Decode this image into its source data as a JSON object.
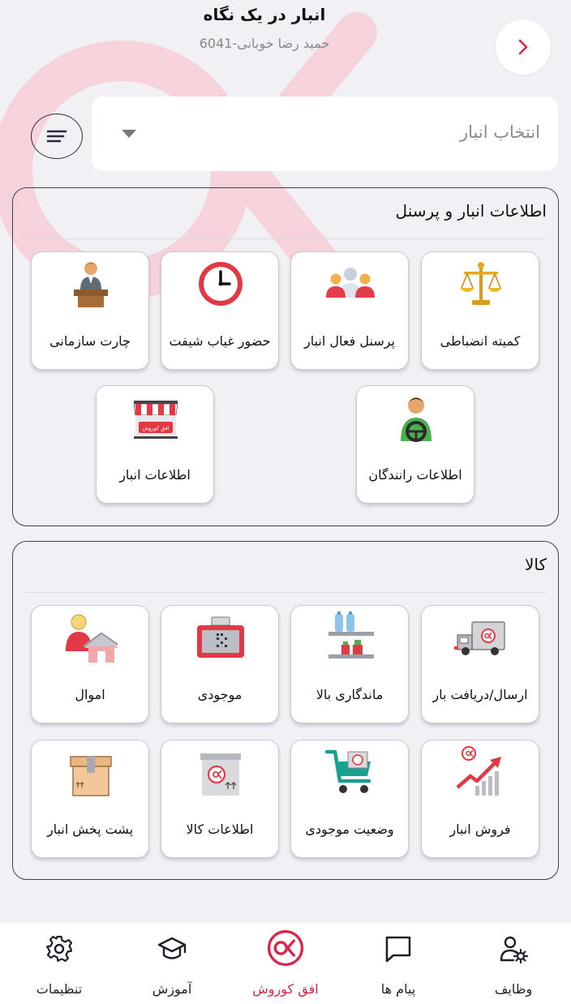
{
  "header": {
    "title": "انبار در یک نگاه",
    "subtitle": "حمید رضا خوبانی-6041"
  },
  "search": {
    "placeholder": "انتخاب انبار"
  },
  "sections": [
    {
      "title": "اطلاعات انبار و پرسنل",
      "cards": [
        {
          "label": "کمیته انضباطی",
          "icon": "scales-of-justice-icon"
        },
        {
          "label": "پرسنل فعال انبار",
          "icon": "people-group-icon"
        },
        {
          "label": "حضور غیاب شیفت",
          "icon": "clock-icon"
        },
        {
          "label": "چارت سازمانی",
          "icon": "speaker-podium-icon"
        },
        {
          "label": "اطلاعات رانندگان",
          "icon": "driver-icon"
        },
        {
          "label": "اطلاعات انبار",
          "icon": "store-awning-icon"
        }
      ]
    },
    {
      "title": "کالا",
      "cards": [
        {
          "label": "ارسال/دریافت بار",
          "icon": "delivery-truck-icon"
        },
        {
          "label": "ماندگاری بالا",
          "icon": "shelf-bottles-icon"
        },
        {
          "label": "موجودی",
          "icon": "cash-register-icon"
        },
        {
          "label": "اموال",
          "icon": "person-house-icon"
        },
        {
          "label": "فروش انبار",
          "icon": "sales-growth-chart-icon"
        },
        {
          "label": "وضعیت موجودی",
          "icon": "shopping-cart-icon"
        },
        {
          "label": "اطلاعات کالا",
          "icon": "product-box-icon"
        },
        {
          "label": "پشت پخش انبار",
          "icon": "parcel-box-icon"
        }
      ]
    }
  ],
  "store_badge_text": "افق کوروش",
  "bottom_nav": [
    {
      "label": "وظایف",
      "icon": "user-gear-icon"
    },
    {
      "label": "پیام ها",
      "icon": "message-icon"
    },
    {
      "label": "افق کوروش",
      "icon": "ofogh-logo-icon",
      "active": true
    },
    {
      "label": "آموزش",
      "icon": "graduation-cap-icon"
    },
    {
      "label": "تنظیمات",
      "icon": "settings-gear-icon"
    }
  ],
  "colors": {
    "accent": "#d8254a",
    "background": "#f1f0f5",
    "card": "#ffffff",
    "border": "#3f3f52"
  }
}
